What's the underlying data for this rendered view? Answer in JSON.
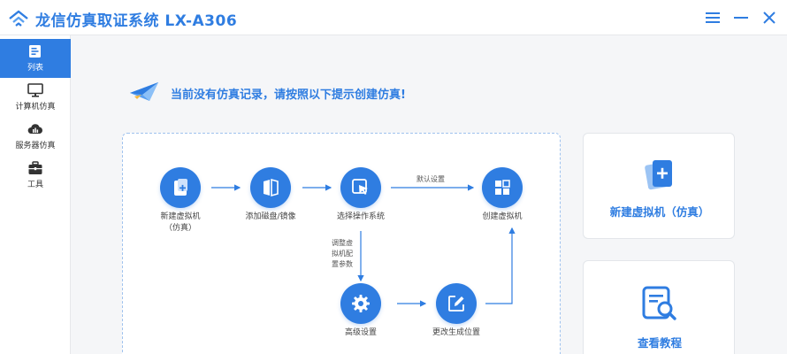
{
  "window": {
    "title": "龙信仿真取证系统 LX-A306"
  },
  "sidebar": {
    "items": [
      {
        "label": "列表",
        "icon": "list-icon",
        "active": true
      },
      {
        "label": "计算机仿真",
        "icon": "monitor-icon",
        "active": false
      },
      {
        "label": "服务器仿真",
        "icon": "server-cloud-icon",
        "active": false
      },
      {
        "label": "工具",
        "icon": "toolbox-icon",
        "active": false
      }
    ]
  },
  "main": {
    "notice": "当前没有仿真记录，请按照以下提示创建仿真!"
  },
  "flow": {
    "nodes": {
      "new_vm": "新建虚拟机\n（仿真）",
      "add_disk": "添加磁盘/镜像",
      "choose_os": "选择操作系统",
      "create_vm": "创建虚拟机",
      "advanced": "高级设置",
      "change_location": "更改生成位置"
    },
    "edges": {
      "default_settings": "默认设置",
      "adjust_params": "调整虚\n拟机配\n置参数"
    }
  },
  "cards": {
    "new_vm": "新建虚拟机（仿真）",
    "tutorial": "查看教程"
  },
  "colors": {
    "accent": "#2f7de1",
    "sidebar_active": "#2f7de1",
    "panel_border": "#9fc2ee"
  }
}
